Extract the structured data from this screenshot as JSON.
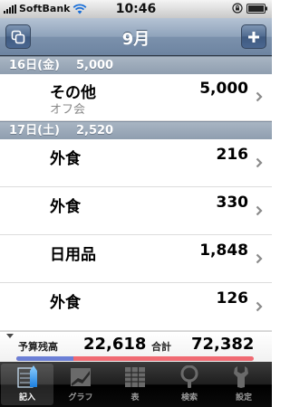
{
  "status": {
    "carrier": "SoftBank",
    "time": "10:46"
  },
  "nav": {
    "title": "9月"
  },
  "sections": [
    {
      "date": "16日(金)",
      "total": "5,000",
      "rows": [
        {
          "category": "その他",
          "memo": "オフ会",
          "amount": "5,000"
        }
      ]
    },
    {
      "date": "17日(土)",
      "total": "2,520",
      "rows": [
        {
          "category": "外食",
          "memo": "",
          "amount": "216"
        },
        {
          "category": "外食",
          "memo": "",
          "amount": "330"
        },
        {
          "category": "日用品",
          "memo": "",
          "amount": "1,848"
        },
        {
          "category": "外食",
          "memo": "",
          "amount": "126"
        }
      ]
    }
  ],
  "budget": {
    "remaining_label": "予算残高",
    "remaining": "22,618",
    "total_label": "合計",
    "total": "72,382",
    "used_fraction": 0.24,
    "colors": {
      "used": "#6b7fd6",
      "rest": "#f06a72"
    }
  },
  "tabs": [
    {
      "label": "記入",
      "icon": "pencil-entry-icon",
      "active": true
    },
    {
      "label": "グラフ",
      "icon": "graph-icon",
      "active": false
    },
    {
      "label": "表",
      "icon": "table-icon",
      "active": false
    },
    {
      "label": "検索",
      "icon": "search-icon",
      "active": false
    },
    {
      "label": "設定",
      "icon": "wrench-settings-icon",
      "active": false
    }
  ]
}
